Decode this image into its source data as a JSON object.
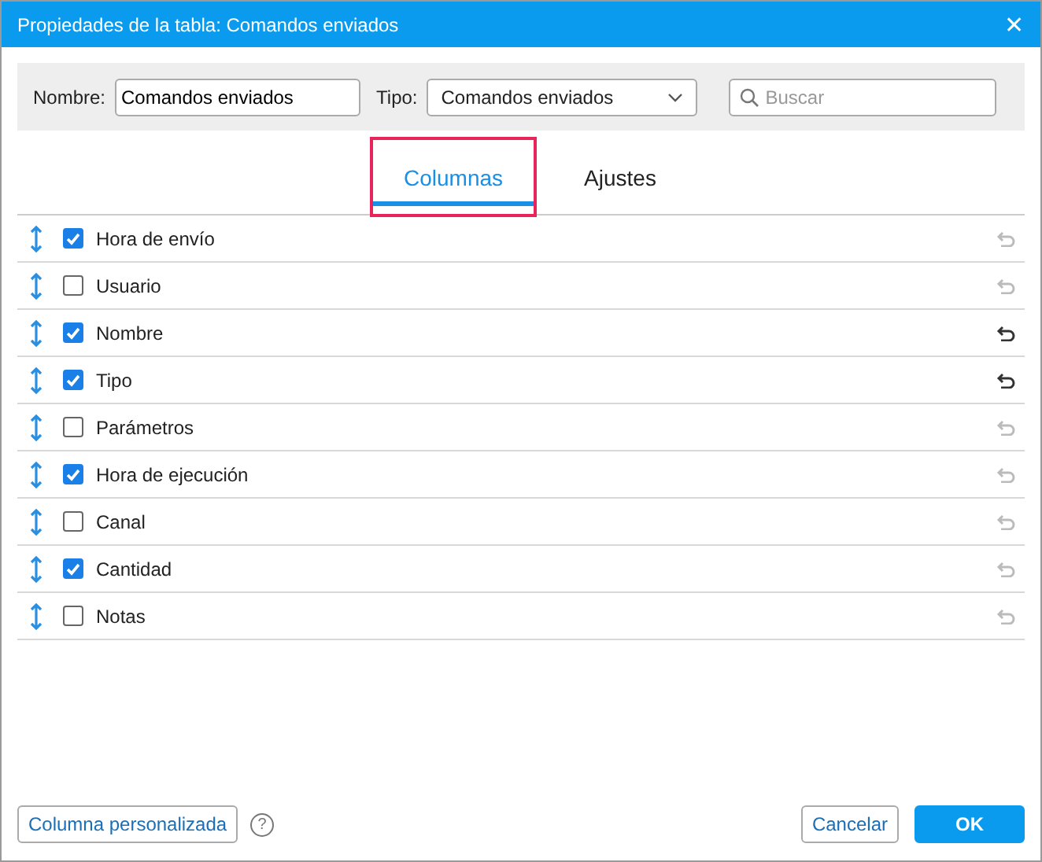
{
  "window": {
    "title": "Propiedades de la tabla: Comandos enviados",
    "close": "✕"
  },
  "filters": {
    "name_label": "Nombre:",
    "name_value": "Comandos enviados",
    "type_label": "Tipo:",
    "type_value": "Comandos enviados",
    "search": {
      "placeholder": "Buscar"
    }
  },
  "tabs": [
    {
      "label": "Columnas",
      "selected": true,
      "highlighted": true
    },
    {
      "label": "Ajustes",
      "selected": false,
      "highlighted": false
    }
  ],
  "columns": [
    {
      "label": "Hora de envío",
      "checked": true,
      "reset_enabled": false
    },
    {
      "label": "Usuario",
      "checked": false,
      "reset_enabled": false
    },
    {
      "label": "Nombre",
      "checked": true,
      "reset_enabled": true
    },
    {
      "label": "Tipo",
      "checked": true,
      "reset_enabled": true
    },
    {
      "label": "Parámetros",
      "checked": false,
      "reset_enabled": false
    },
    {
      "label": "Hora de ejecución",
      "checked": true,
      "reset_enabled": false
    },
    {
      "label": "Canal",
      "checked": false,
      "reset_enabled": false
    },
    {
      "label": "Cantidad",
      "checked": true,
      "reset_enabled": false
    },
    {
      "label": "Notas",
      "checked": false,
      "reset_enabled": false
    }
  ],
  "footer": {
    "custom_column": "Columna personalizada",
    "help": "?",
    "cancel": "Cancelar",
    "ok": "OK"
  }
}
